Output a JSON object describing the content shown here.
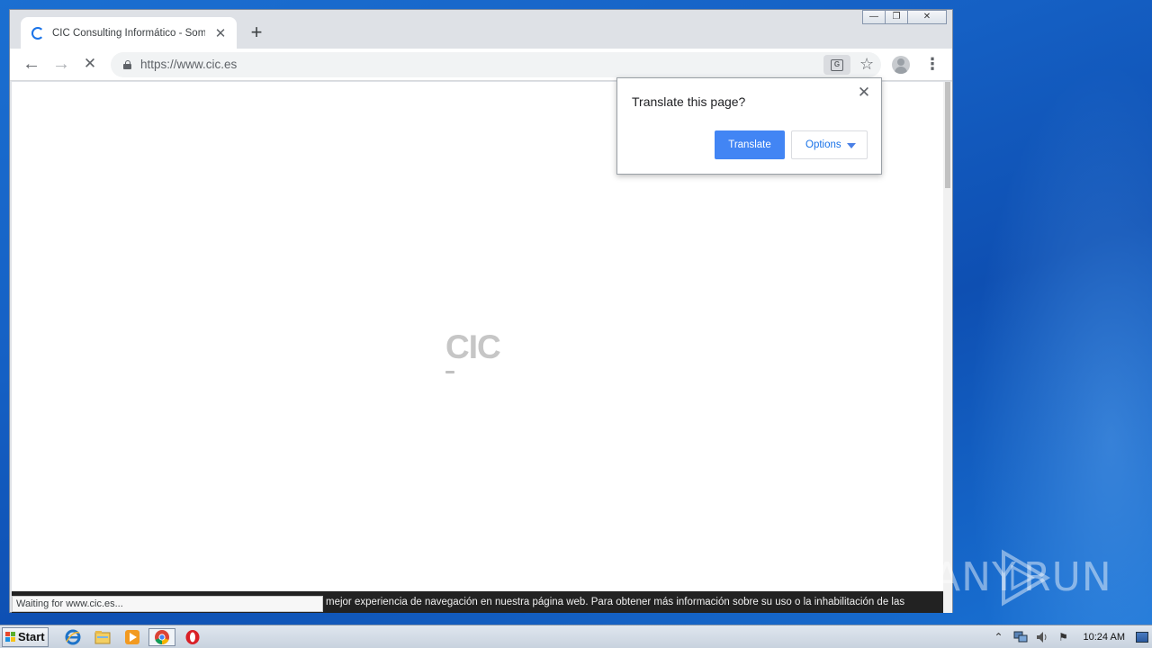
{
  "browser": {
    "tab": {
      "title": "CIC Consulting Informático - Somos Ingenieros",
      "close_symbol": "✕"
    },
    "new_tab_symbol": "+",
    "window_controls": {
      "minimize": "—",
      "restore": "❐",
      "close": "✕"
    },
    "nav": {
      "back": "←",
      "forward": "→",
      "stop": "✕"
    },
    "address_bar": {
      "url": "https://www.cic.es"
    },
    "icons": {
      "translate": "translate-icon",
      "bookmark": "star-icon",
      "profile": "avatar-icon",
      "menu": "kebab-menu-icon"
    },
    "star_symbol": "☆",
    "menu_symbol": "⋮"
  },
  "page": {
    "logo_text": "CIC",
    "cookie_text": "mejor experiencia de navegación en nuestra página web. Para obtener más información sobre su uso o la inhabilitación de las",
    "status_text": "Waiting for www.cic.es..."
  },
  "translate_popup": {
    "title": "Translate this page?",
    "close_symbol": "✕",
    "translate_label": "Translate",
    "options_label": "Options"
  },
  "watermark": {
    "left": "ANY",
    "right": "RUN"
  },
  "taskbar": {
    "start_label": "Start",
    "apps": [
      "internet-explorer-icon",
      "file-explorer-icon",
      "media-player-icon",
      "chrome-icon",
      "opera-icon"
    ],
    "clock": "10:24 AM",
    "tray": {
      "chevron": "⌃",
      "sound": "🔈",
      "flag": "⚑"
    }
  },
  "colors": {
    "accent": "#4285f4",
    "desktop": "#1560c4"
  }
}
